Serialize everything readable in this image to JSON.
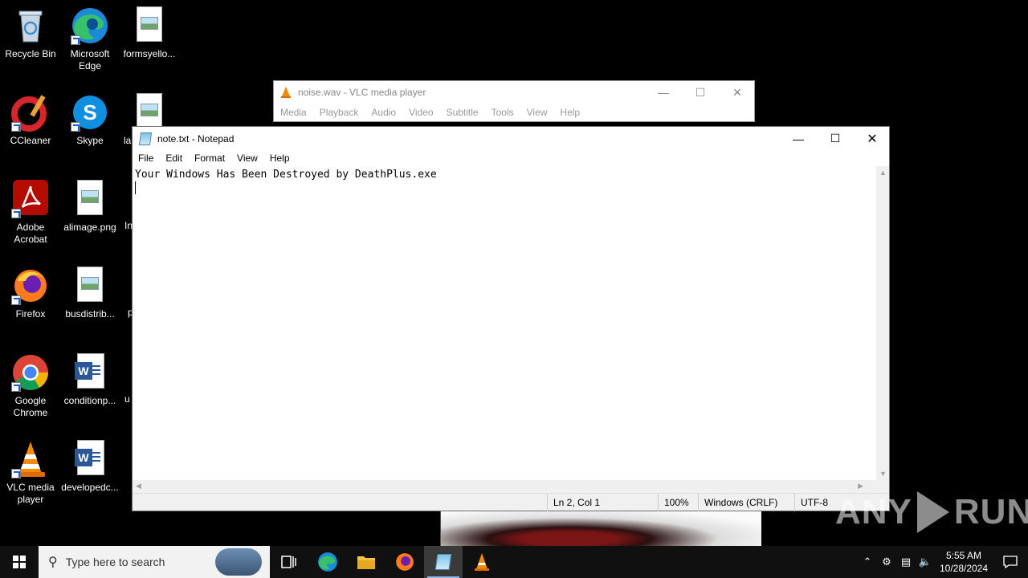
{
  "desktop_icons": [
    {
      "label": "Recycle Bin"
    },
    {
      "label": "Microsoft Edge"
    },
    {
      "label": "formsyello..."
    },
    {
      "label": "CCleaner"
    },
    {
      "label": "Skype"
    },
    {
      "label": "la"
    },
    {
      "label": "Adobe Acrobat"
    },
    {
      "label": "alimage.png"
    },
    {
      "label": "In"
    },
    {
      "label": "Firefox"
    },
    {
      "label": "busdistrib..."
    },
    {
      "label": "p"
    },
    {
      "label": "Google Chrome"
    },
    {
      "label": "conditionp..."
    },
    {
      "label": "u"
    },
    {
      "label": "VLC media player"
    },
    {
      "label": "developedc..."
    }
  ],
  "vlc": {
    "title": "noise.wav - VLC media player",
    "menu": [
      "Media",
      "Playback",
      "Audio",
      "Video",
      "Subtitle",
      "Tools",
      "View",
      "Help"
    ]
  },
  "notepad": {
    "title": "note.txt - Notepad",
    "menu": [
      "File",
      "Edit",
      "Format",
      "View",
      "Help"
    ],
    "content": "Your Windows Has Been Destroyed by DeathPlus.exe",
    "status": {
      "position": "Ln 2, Col 1",
      "zoom": "100%",
      "line_ending": "Windows (CRLF)",
      "encoding": "UTF-8"
    }
  },
  "watermark": {
    "left": "ANY",
    "right": "RUN"
  },
  "taskbar": {
    "search_placeholder": "Type here to search",
    "time": "5:55 AM",
    "date": "10/28/2024"
  }
}
